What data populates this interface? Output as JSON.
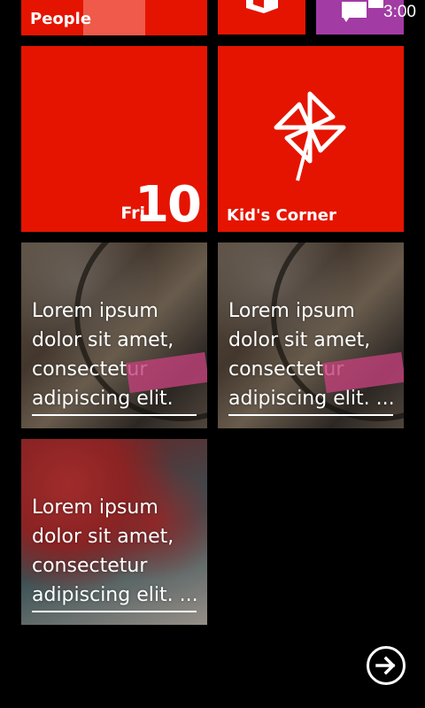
{
  "status_bar": {
    "time": "3:00"
  },
  "tiles": {
    "people": {
      "label": "People"
    },
    "calendar": {
      "day": "Fri",
      "date": "10"
    },
    "kids_corner": {
      "label": "Kid's Corner",
      "icon": "pinwheel-icon"
    },
    "office": {
      "icon": "office-icon"
    },
    "messaging": {
      "icon": "messaging-icon"
    },
    "photo_tiles": [
      {
        "lines": [
          "Lorem ipsum",
          "dolor sit amet,",
          "consectetur",
          "adipiscing elit."
        ]
      },
      {
        "lines": [
          "Lorem ipsum",
          "dolor sit amet,",
          "consectetur",
          "adipiscing elit. ..."
        ]
      },
      {
        "lines": [
          "Lorem ipsum",
          "dolor sit amet,",
          "consectetur",
          "adipiscing elit. ..."
        ]
      }
    ]
  },
  "all_apps_button": {
    "icon": "arrow-right-circle-icon"
  },
  "colors": {
    "accent": "#e51400",
    "secondary": "#a23ba4",
    "background": "#000000"
  }
}
